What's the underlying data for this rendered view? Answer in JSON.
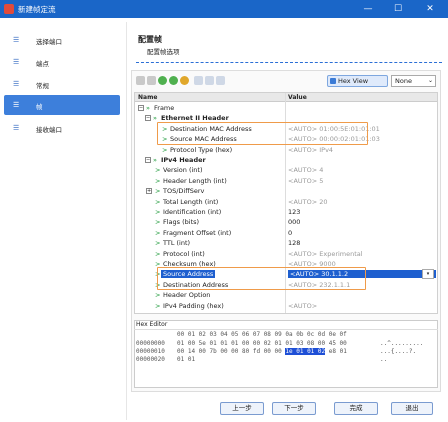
{
  "window": {
    "title": "新建帧定流",
    "minimize": "—",
    "maximize": "☐",
    "close": "✕"
  },
  "sidebar": {
    "items": [
      {
        "label": "选择端口",
        "icon": "list-icon"
      },
      {
        "label": "端点",
        "icon": "list-icon"
      },
      {
        "label": "常规",
        "icon": "list-icon"
      },
      {
        "label": "帧",
        "icon": "list-icon",
        "active": true
      },
      {
        "label": "接收端口",
        "icon": "list-icon"
      }
    ]
  },
  "header": {
    "title": "配置帧",
    "subtitle": "配置帧选项"
  },
  "toolbar": {
    "hex_view_label": "Hex View",
    "combo_value": "None",
    "combo_arrow": "⌄"
  },
  "grid": {
    "col_name": "Name",
    "col_value": "Value",
    "rows": [
      {
        "name": "Frame",
        "value": ""
      },
      {
        "name": "Ethernet II Header",
        "value": ""
      },
      {
        "name": "Destination MAC Address",
        "value": "<AUTO> 01:00:5E:01:01:01"
      },
      {
        "name": "Source MAC Address",
        "value": "<AUTO> 00:00:02:01:01:03"
      },
      {
        "name": "Protocol Type (hex)",
        "value": "<AUTO> IPv4"
      },
      {
        "name": "IPv4 Header",
        "value": ""
      },
      {
        "name": "Version (int)",
        "value": "<AUTO> 4"
      },
      {
        "name": "Header Length (int)",
        "value": "<AUTO> 5"
      },
      {
        "name": "TOS/DiffServ",
        "value": ""
      },
      {
        "name": "Total Length (int)",
        "value": "<AUTO> 20"
      },
      {
        "name": "Identification  (int)",
        "value": "123"
      },
      {
        "name": "Flags (bits)",
        "value": "000"
      },
      {
        "name": "Fragment Offset (int)",
        "value": "0"
      },
      {
        "name": "TTL (int)",
        "value": "128"
      },
      {
        "name": "Protocol (int)",
        "value": "<AUTO> Experimental"
      },
      {
        "name": "Checksum (hex)",
        "value": "<AUTO> 9000"
      },
      {
        "name": "Source Address",
        "value": "<AUTO> 30.1.1.2"
      },
      {
        "name": "Destination Address",
        "value": "<AUTO> 232.1.1.1"
      },
      {
        "name": "Header Option",
        "value": ""
      },
      {
        "name": "IPv4 Padding (hex)",
        "value": "<AUTO>"
      }
    ]
  },
  "hex_editor": {
    "label": "Hex Editor",
    "header": "00 01 02 03 04 05 06 07 08 09 0a 0b 0c 0d 0e 0f",
    "rows": [
      {
        "offset": "00000000",
        "hex": "01 00 5e 01 01 01 00 00 02 01 01 03 08 00 45 00",
        "ascii": "..^........."
      },
      {
        "offset": "00000010",
        "hex_pre": "00 14 00 7b 00 00 80 fd 00 00",
        "hex_sel": "1e 01 01 02",
        "hex_post": "e8 01",
        "ascii": "...{....?."
      },
      {
        "offset": "00000020",
        "hex": "01 01",
        "ascii": ".."
      }
    ]
  },
  "footer": {
    "prev": "上一步",
    "next": "下一步",
    "finish": "完成",
    "exit": "退出"
  },
  "colors": {
    "title_bar": "#1a66c8",
    "active_nav": "#3d7fdb",
    "highlight": "#ef9b4a",
    "selection": "#1e5fcf"
  }
}
